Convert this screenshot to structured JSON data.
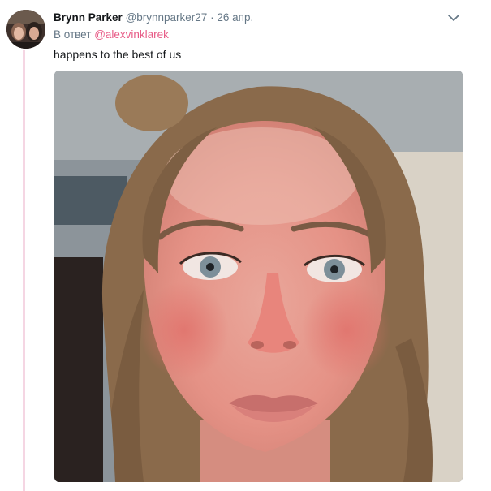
{
  "tweet": {
    "display_name": "Brynn Parker",
    "handle": "@brynnparker27",
    "separator": "·",
    "date": "26 апр.",
    "reply_prefix": "В ответ",
    "reply_to": "@alexvinklarek",
    "text": "happens to the best of us",
    "accent_color": "#e0245e",
    "thread_line_color": "#f5d6e3",
    "icons": {
      "more": "chevron-down-icon"
    }
  }
}
